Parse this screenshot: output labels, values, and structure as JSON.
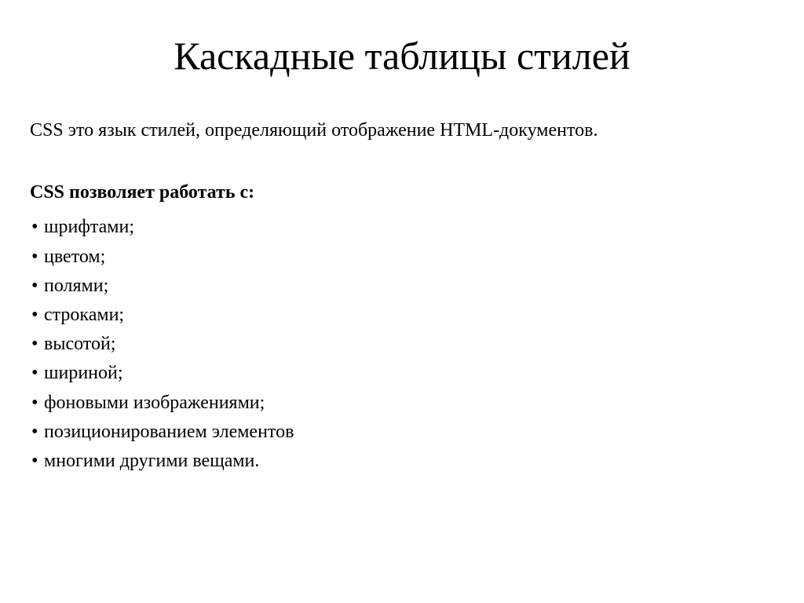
{
  "title": "Каскадные таблицы стилей",
  "intro": "CSS это язык стилей, определяющий отображение HTML-документов.",
  "subhead": "CSS позволяет работать с:",
  "bullets": [
    "шрифтами;",
    "цветом;",
    "полями;",
    "строками;",
    "высотой;",
    "шириной;",
    "фоновыми изображениями;",
    "позиционированием элементов",
    "многими другими вещами."
  ]
}
